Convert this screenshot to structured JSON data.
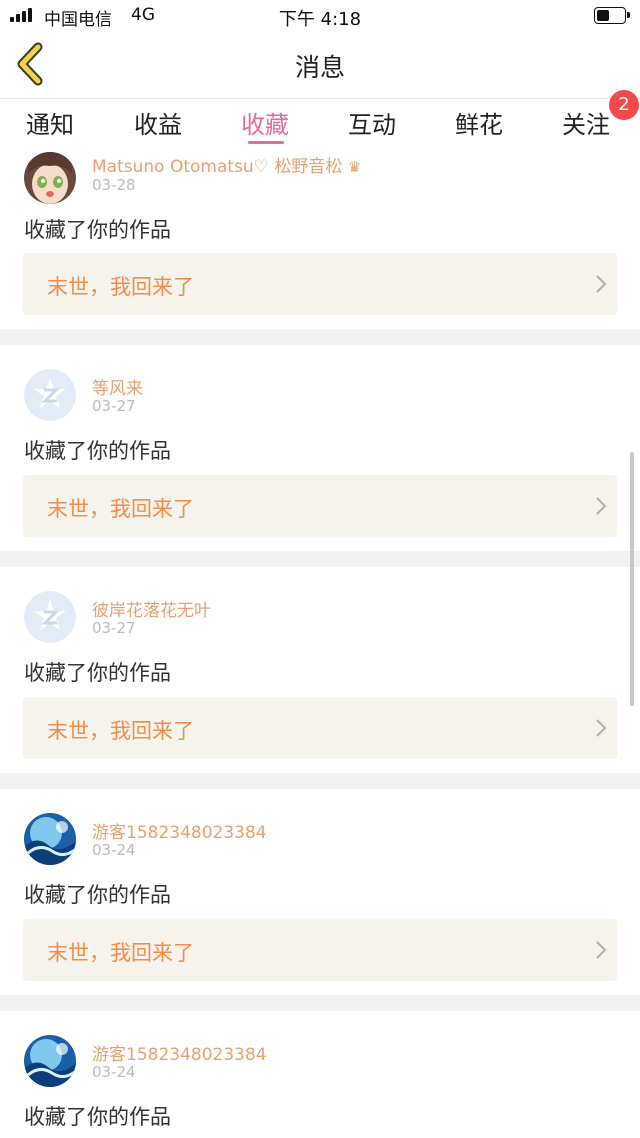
{
  "status_bar": {
    "carrier": "中国电信",
    "network": "4G",
    "time": "下午 4:18"
  },
  "header": {
    "title": "消息",
    "back_icon": "chevron-left-icon"
  },
  "tabs": [
    {
      "label": "通知"
    },
    {
      "label": "收益"
    },
    {
      "label": "收藏",
      "active": true
    },
    {
      "label": "互动"
    },
    {
      "label": "鲜花"
    },
    {
      "label": "关注",
      "badge": "2"
    }
  ],
  "colors": {
    "accent": "#e86aa0",
    "username": "#e7a172",
    "work_title": "#f08e4a",
    "badge": "#f24a4a",
    "work_bg": "#f5f3ec"
  },
  "items": [
    {
      "username": "Matsuno Otomatsu♡ 松野音松",
      "crown": "♛",
      "date": "03-28",
      "action": "收藏了你的作品",
      "work_title": "末世，我回来了",
      "avatar": "anime-girl-avatar"
    },
    {
      "username": "等风来",
      "date": "03-27",
      "action": "收藏了你的作品",
      "work_title": "末世，我回来了",
      "avatar": "default-z-avatar"
    },
    {
      "username": "彼岸花落花无叶",
      "date": "03-27",
      "action": "收藏了你的作品",
      "work_title": "末世，我回来了",
      "avatar": "default-z-avatar"
    },
    {
      "username": "游客1582348023384",
      "date": "03-24",
      "action": "收藏了你的作品",
      "work_title": "末世，我回来了",
      "avatar": "blue-wave-avatar"
    },
    {
      "username": "游客1582348023384",
      "date": "03-24",
      "action": "收藏了你的作品",
      "avatar": "blue-wave-avatar"
    }
  ]
}
